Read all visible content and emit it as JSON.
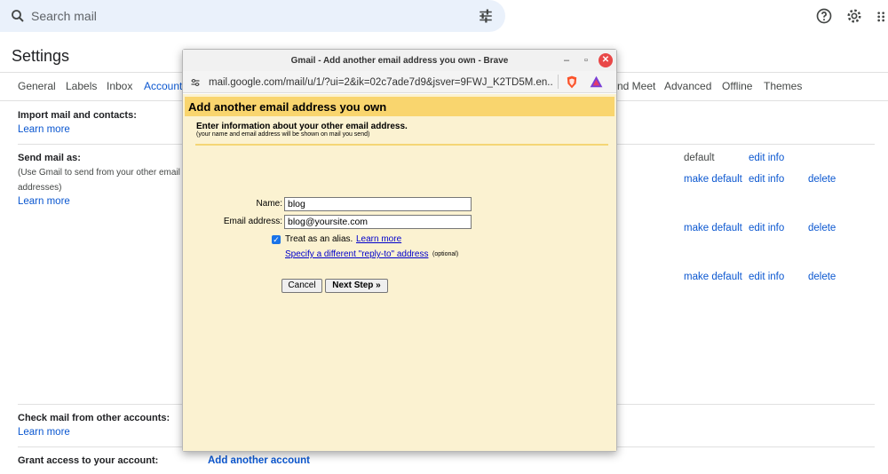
{
  "search": {
    "placeholder": "Search mail"
  },
  "settings": {
    "title": "Settings",
    "tabs": [
      "General",
      "Labels",
      "Inbox",
      "Accounts",
      "nd Meet",
      "Advanced",
      "Offline",
      "Themes"
    ],
    "import": {
      "title": "Import mail and contacts:",
      "learn_more": "Learn more"
    },
    "send_mail": {
      "title": "Send mail as:",
      "desc1": "(Use Gmail to send from your other email",
      "desc2": "addresses)",
      "learn_more": "Learn more",
      "rows": [
        {
          "status": "default",
          "edit": "edit info"
        },
        {
          "make_default": "make default",
          "edit": "edit info",
          "delete": "delete"
        },
        {
          "make_default": "make default",
          "edit": "edit info",
          "delete": "delete"
        },
        {
          "make_default": "make default",
          "edit": "edit info",
          "delete": "delete"
        }
      ]
    },
    "check_mail": {
      "title": "Check mail from other accounts:",
      "learn_more": "Learn more"
    },
    "grant": {
      "title": "Grant access to your account:",
      "add": "Add another account"
    }
  },
  "popup": {
    "window_title": "Gmail - Add another email address you own - Brave",
    "url": "mail.google.com/mail/u/1/?ui=2&ik=02c7ade7d9&jsver=9FWJ_K2TD5M.en....",
    "header": "Add another email address you own",
    "intro": "Enter information about your other email address.",
    "intro_small": "(your name and email address will be shown on mail you send)",
    "name_label": "Name:",
    "name_value": "blog",
    "email_label": "Email address:",
    "email_value": "blog@yoursite.com",
    "alias_text": "Treat as an alias.",
    "alias_learn_more": "Learn more",
    "reply_to_link": "Specify a different \"reply-to\" address",
    "optional": "(optional)",
    "cancel": "Cancel",
    "next": "Next Step »"
  },
  "colors": {
    "accent": "#0b57d0",
    "popup_header": "#f9d56e",
    "popup_body": "#fbf2d1"
  }
}
